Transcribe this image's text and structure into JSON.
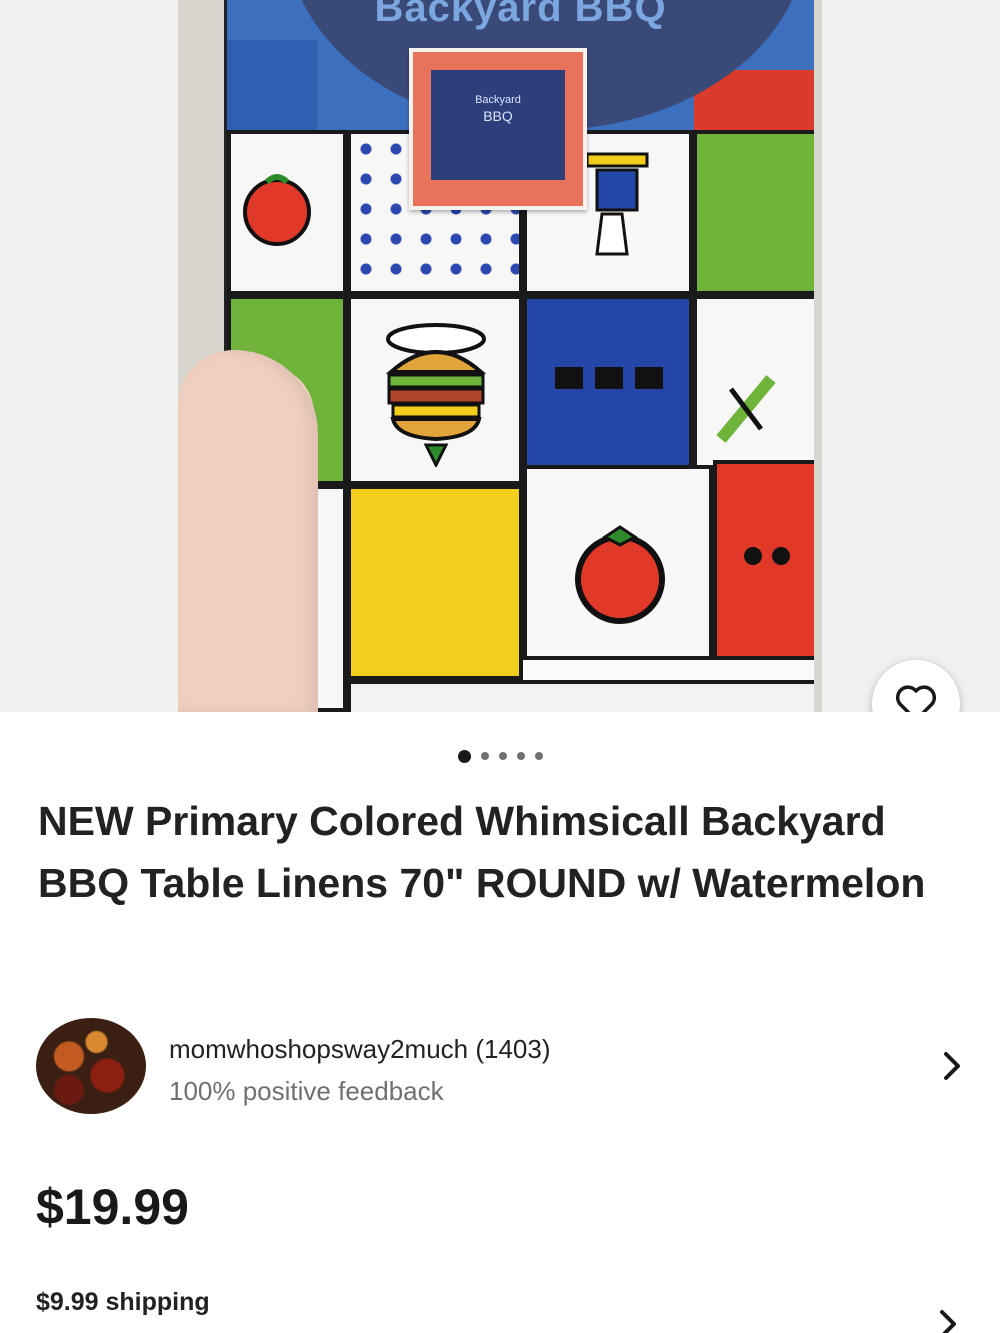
{
  "gallery": {
    "package_brand": "Backyard BBQ",
    "label_text": [
      "Backyard",
      "BBQ"
    ],
    "page_count": 5,
    "active_page": 1
  },
  "icons": {
    "favorite": "heart-icon",
    "seller_chevron": "chevron-right-icon",
    "shipping_chevron": "chevron-right-icon"
  },
  "listing": {
    "title": "NEW Primary Colored Whimsicall Backyard BBQ Table Linens 70\" ROUND w/ Watermelon",
    "price": "$19.99",
    "shipping": "$9.99 shipping"
  },
  "seller": {
    "name": "momwhoshopsway2much (1403)",
    "feedback": "100% positive feedback"
  },
  "colors": {
    "text": "#191919",
    "muted": "#707070",
    "cell_blue": "#2446a8",
    "cell_green": "#6fb33a",
    "cell_yellow": "#f2cf1d",
    "cell_red": "#e0392a"
  }
}
